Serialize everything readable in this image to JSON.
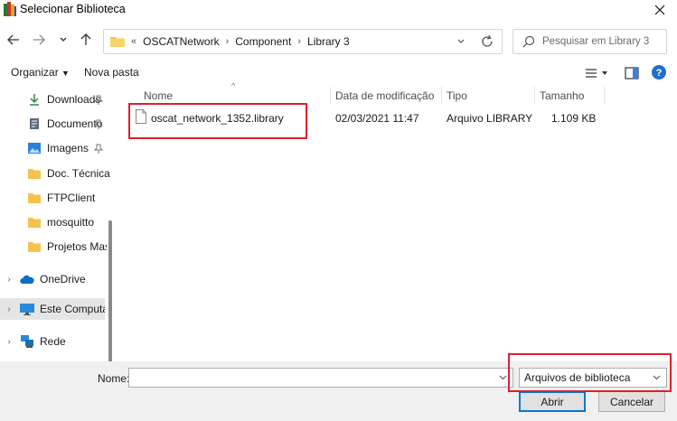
{
  "window": {
    "title": "Selecionar Biblioteca"
  },
  "address": {
    "overflow": "«",
    "crumbs": [
      "OSCATNetwork",
      "Component",
      "Library 3"
    ]
  },
  "search": {
    "placeholder": "Pesquisar em Library 3"
  },
  "toolbar": {
    "organize": "Organizar",
    "new_folder": "Nova pasta"
  },
  "sidebar": {
    "items": [
      {
        "label": "Downloads",
        "icon": "download-icon",
        "pinned": true
      },
      {
        "label": "Documento",
        "icon": "document-icon",
        "pinned": true
      },
      {
        "label": "Imagens",
        "icon": "images-icon",
        "pinned": true
      },
      {
        "label": "Doc. Técnica",
        "icon": "folder-icon",
        "pinned": false
      },
      {
        "label": "FTPClient",
        "icon": "folder-icon",
        "pinned": false
      },
      {
        "label": "mosquitto",
        "icon": "folder-icon",
        "pinned": false
      },
      {
        "label": "Projetos Master",
        "icon": "folder-icon",
        "pinned": false
      },
      {
        "label": "OneDrive",
        "icon": "cloud-icon",
        "expandable": true
      },
      {
        "label": "Este Computador",
        "icon": "computer-icon",
        "expandable": true,
        "selected": true
      },
      {
        "label": "Rede",
        "icon": "network-icon",
        "expandable": true
      }
    ]
  },
  "columns": {
    "name": "Nome",
    "modified": "Data de modificação",
    "type": "Tipo",
    "size": "Tamanho"
  },
  "files": [
    {
      "name": "oscat_network_1352.library",
      "modified": "02/03/2021 11:47",
      "type": "Arquivo LIBRARY",
      "size": "1.109 KB"
    }
  ],
  "bottom": {
    "name_label": "Nome:",
    "name_value": "",
    "filter": "Arquivos de biblioteca",
    "open": "Abrir",
    "cancel": "Cancelar"
  },
  "colors": {
    "highlight": "#e0202a",
    "accent": "#0078d7",
    "folder": "#f4c24e"
  }
}
